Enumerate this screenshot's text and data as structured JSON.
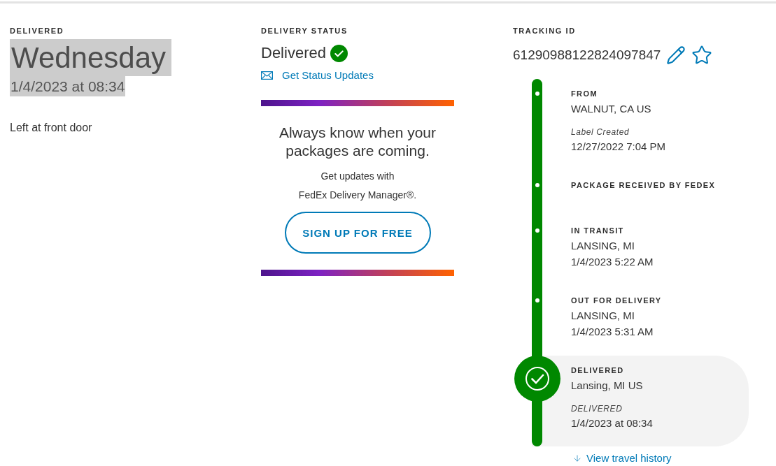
{
  "delivered": {
    "label": "DELIVERED",
    "day": "Wednesday",
    "datetime": "1/4/2023 at 08:34",
    "highlighted": true,
    "note": "Left at front door"
  },
  "status": {
    "label": "DELIVERY STATUS",
    "value": "Delivered",
    "link": "Get Status Updates"
  },
  "promo": {
    "headline": "Always know when your packages are coming.",
    "lines": [
      "Get updates with",
      "FedEx Delivery Manager®."
    ],
    "button": "SIGN UP FOR FREE"
  },
  "tracking": {
    "label": "TRACKING ID",
    "number": "61290988122824097847",
    "starred": false
  },
  "timeline": {
    "events": [
      {
        "kind": "step",
        "title": "FROM",
        "location": "WALNUT, CA US",
        "note": "Label Created",
        "time": "12/27/2022 7:04 PM"
      },
      {
        "kind": "step",
        "title": "PACKAGE RECEIVED BY FEDEX"
      },
      {
        "kind": "step",
        "title": "IN TRANSIT",
        "location": "LANSING, MI",
        "time": "1/4/2023 5:22 AM"
      },
      {
        "kind": "step",
        "title": "OUT FOR DELIVERY",
        "location": "LANSING, MI",
        "time": "1/4/2023 5:31 AM"
      },
      {
        "kind": "current",
        "title": "DELIVERED",
        "location": "Lansing, MI US",
        "note": "DELIVERED",
        "time": "1/4/2023 at 08:34"
      }
    ],
    "history_link": "View travel history"
  }
}
